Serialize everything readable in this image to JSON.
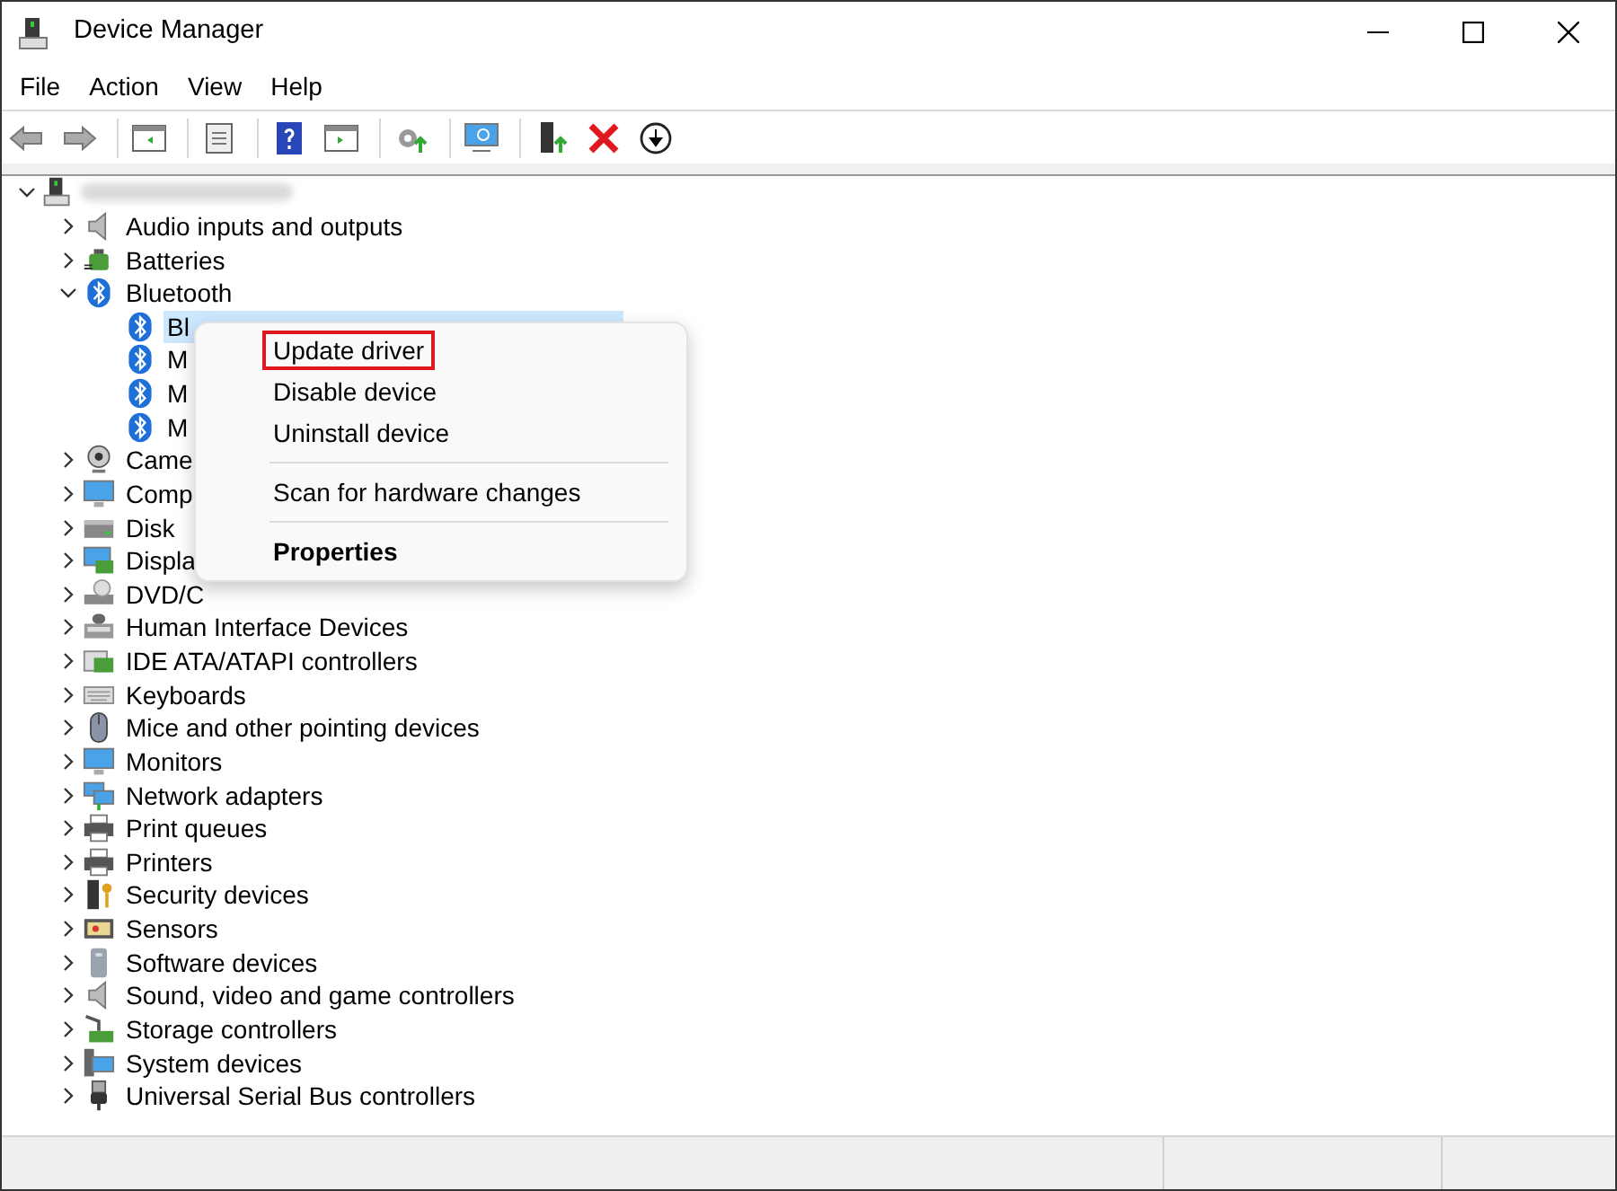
{
  "window": {
    "title": "Device Manager"
  },
  "menu_bar": [
    "File",
    "Action",
    "View",
    "Help"
  ],
  "tree": {
    "root": {
      "expanded": true,
      "children": [
        {
          "label": "Audio inputs and outputs",
          "expanded": false
        },
        {
          "label": "Batteries",
          "expanded": false
        },
        {
          "label": "Bluetooth",
          "expanded": true,
          "children": [
            {
              "label": "Bl",
              "selected": true
            },
            {
              "label": "M",
              "selected": false
            },
            {
              "label": "M",
              "selected": false
            },
            {
              "label": "M",
              "selected": false
            }
          ]
        },
        {
          "label": "Came",
          "expanded": false
        },
        {
          "label": "Comp",
          "expanded": false
        },
        {
          "label": "Disk",
          "expanded": false
        },
        {
          "label": "Displa",
          "expanded": false
        },
        {
          "label": "DVD/C",
          "expanded": false
        },
        {
          "label": "Human Interface Devices",
          "expanded": false
        },
        {
          "label": "IDE ATA/ATAPI controllers",
          "expanded": false
        },
        {
          "label": "Keyboards",
          "expanded": false
        },
        {
          "label": "Mice and other pointing devices",
          "expanded": false
        },
        {
          "label": "Monitors",
          "expanded": false
        },
        {
          "label": "Network adapters",
          "expanded": false
        },
        {
          "label": "Print queues",
          "expanded": false
        },
        {
          "label": "Printers",
          "expanded": false
        },
        {
          "label": "Security devices",
          "expanded": false
        },
        {
          "label": "Sensors",
          "expanded": false
        },
        {
          "label": "Software devices",
          "expanded": false
        },
        {
          "label": "Sound, video and game controllers",
          "expanded": false
        },
        {
          "label": "Storage controllers",
          "expanded": false
        },
        {
          "label": "System devices",
          "expanded": false
        },
        {
          "label": "Universal Serial Bus controllers",
          "expanded": false
        }
      ]
    }
  },
  "context_menu": {
    "items": [
      {
        "kind": "item",
        "label": "Update driver",
        "outlined": true
      },
      {
        "kind": "item",
        "label": "Disable device",
        "outlined": false
      },
      {
        "kind": "item",
        "label": "Uninstall device",
        "outlined": false
      },
      {
        "kind": "separator"
      },
      {
        "kind": "item",
        "label": "Scan for hardware changes",
        "outlined": false
      },
      {
        "kind": "separator"
      },
      {
        "kind": "default",
        "label": "Properties",
        "outlined": false
      }
    ]
  }
}
